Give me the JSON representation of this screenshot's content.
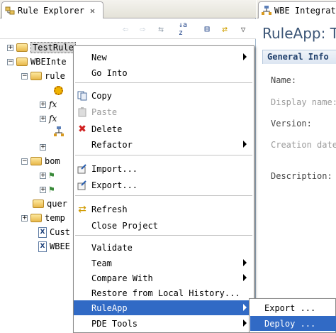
{
  "left_view": {
    "tab_title": "Rule Explorer",
    "tab_close": "✕",
    "toolbar": {
      "back": "⇦",
      "forward": "⇨",
      "link": "⇆",
      "sort": "↓a z",
      "collapse": "⊟",
      "sync": "⇄",
      "menu": "▽"
    },
    "tree": [
      {
        "label": "TestRule",
        "expander": "+",
        "selected": true
      },
      {
        "label": "WBEInte",
        "expander": "−"
      },
      {
        "label": "rule",
        "expander": "−"
      },
      {
        "label": "",
        "icon": "gear"
      },
      {
        "label": "",
        "expander": "+",
        "icon": "fx"
      },
      {
        "label": "",
        "expander": "+",
        "icon": "fx"
      },
      {
        "label": "",
        "icon": "ruleflow"
      },
      {
        "label": "",
        "expander": "+"
      },
      {
        "label": "bom",
        "expander": "−"
      },
      {
        "label": "",
        "expander": "+"
      },
      {
        "label": "",
        "expander": "+"
      },
      {
        "label": "quer"
      },
      {
        "label": "temp",
        "expander": "+"
      },
      {
        "label": "Cust"
      },
      {
        "label": "WBEE"
      }
    ]
  },
  "right_view": {
    "tab_title": "WBE Integrat",
    "heading": "RuleApp: T",
    "section_title": "General Info",
    "fields": {
      "name": "Name:",
      "display_name": "Display name:",
      "version": "Version:",
      "creation_date": "Creation date",
      "description": "Description:"
    }
  },
  "context_menu": {
    "new": "New",
    "go_into": "Go Into",
    "copy": "Copy",
    "paste": "Paste",
    "delete": "Delete",
    "refactor": "Refactor",
    "import": "Import...",
    "export": "Export...",
    "refresh": "Refresh",
    "close_project": "Close Project",
    "validate": "Validate",
    "team": "Team",
    "compare_with": "Compare With",
    "restore_history": "Restore from Local History...",
    "ruleapp": "RuleApp",
    "pde_tools": "PDE Tools"
  },
  "submenu": {
    "export": "Export ...",
    "deploy": "Deploy ..."
  },
  "colors": {
    "highlight": "#316ac5",
    "heading": "#3b5576",
    "delete_icon": "#d02020"
  }
}
